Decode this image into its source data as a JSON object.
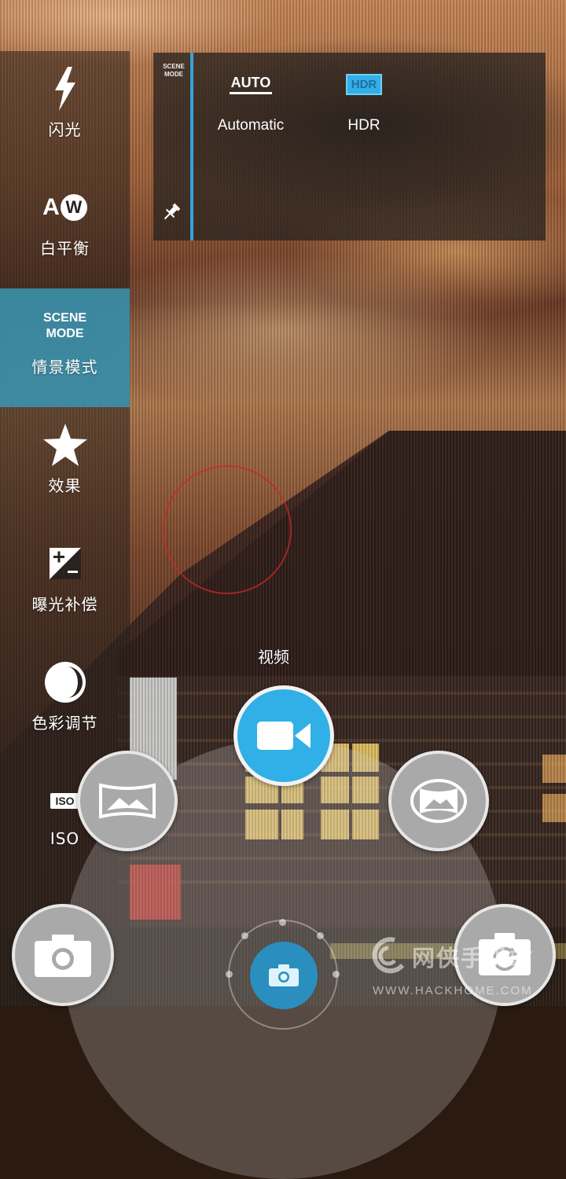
{
  "settings_menu": {
    "items": [
      {
        "label": "闪光",
        "icon": "flash-icon"
      },
      {
        "label": "白平衡",
        "icon": "auto-white-balance-icon",
        "icon_text_a": "A",
        "icon_text_w": "W"
      },
      {
        "label": "情景模式",
        "icon": "scene-mode-icon",
        "icon_text": "SCENE\nMODE",
        "active": true
      },
      {
        "label": "效果",
        "icon": "star-icon"
      },
      {
        "label": "曝光补偿",
        "icon": "exposure-compensation-icon"
      },
      {
        "label": "色彩调节",
        "icon": "color-adjust-icon"
      },
      {
        "label": "ISO",
        "icon": "iso-icon",
        "icon_text": "ISO"
      }
    ]
  },
  "scene_panel": {
    "tag": "SCENE\nMODE",
    "options": [
      {
        "icon_text": "AUTO",
        "label": "Automatic"
      },
      {
        "icon_text": "HDR",
        "label": "HDR"
      }
    ]
  },
  "mode_selector": {
    "current_label": "视频",
    "modes": [
      "panorama-icon",
      "video-icon",
      "photosphere-icon",
      "camera-icon",
      "switch-camera-icon"
    ]
  },
  "watermark": {
    "title": "网侠手机站",
    "url": "WWW.HACKHOME.COM"
  },
  "colors": {
    "accent": "#34a4d8",
    "active_item": "#3a96b4",
    "video_button": "#30b0e6"
  }
}
